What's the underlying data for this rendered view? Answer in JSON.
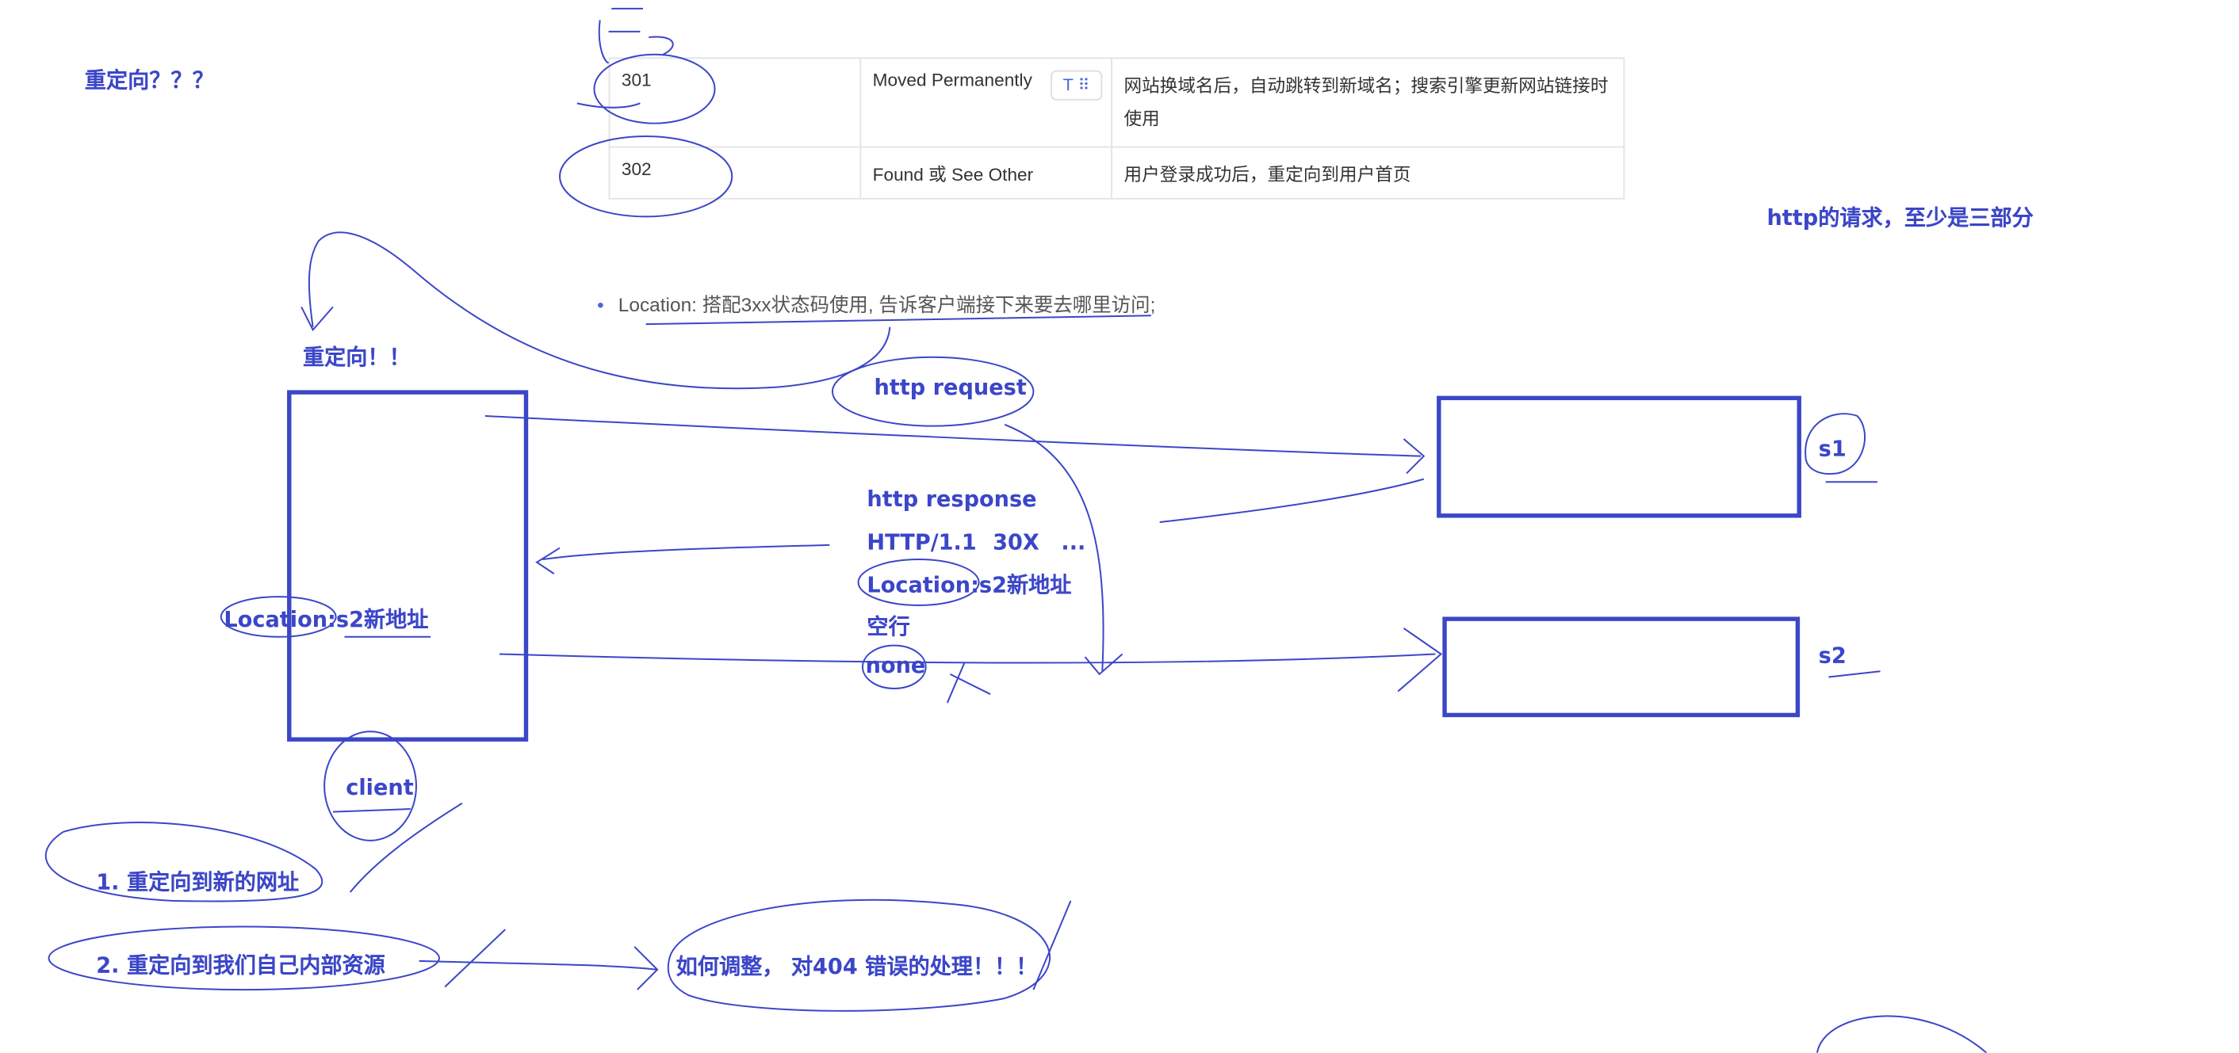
{
  "title_note": "重定向？？？",
  "table": {
    "rows": [
      {
        "code": "301",
        "name": "Moved Permanently",
        "desc_line1": "网站换域名后，自动跳转到新域名；搜索引擎更新网站链接时",
        "desc_line2": "使用"
      },
      {
        "code": "302",
        "name": "Found 或 See Other",
        "desc_line1": "用户登录成功后，重定向到用户首页",
        "desc_line2": ""
      }
    ],
    "tool_button": "T ⠿"
  },
  "bullet": {
    "text": "Location: 搭配3xx状态码使用, 告诉客户端接下来要去哪里访问;"
  },
  "notes": {
    "http_request_parts": "http的请求，至少是三部分",
    "redirect": "重定向！！",
    "http_request": "http request",
    "http_response": "http response",
    "status_line_a": "HTTP/1.1",
    "status_line_b": "30X",
    "status_line_c": "...",
    "location_header_key": "Location:",
    "location_header_val": "s2新地址",
    "blank_line": "空行",
    "body_none": "none",
    "client_location_key": "Location:",
    "client_location_val": "s2新地址",
    "client": "client",
    "s1": "s1",
    "s2": "s2",
    "point1": "1. 重定向到新的网址",
    "point2": "2. 重定向到我们自己内部资源",
    "point3": "如何调整， 对404 错误的处理！！！"
  },
  "colors": {
    "ink": "#3b46c8",
    "accent": "#4a64d8"
  }
}
